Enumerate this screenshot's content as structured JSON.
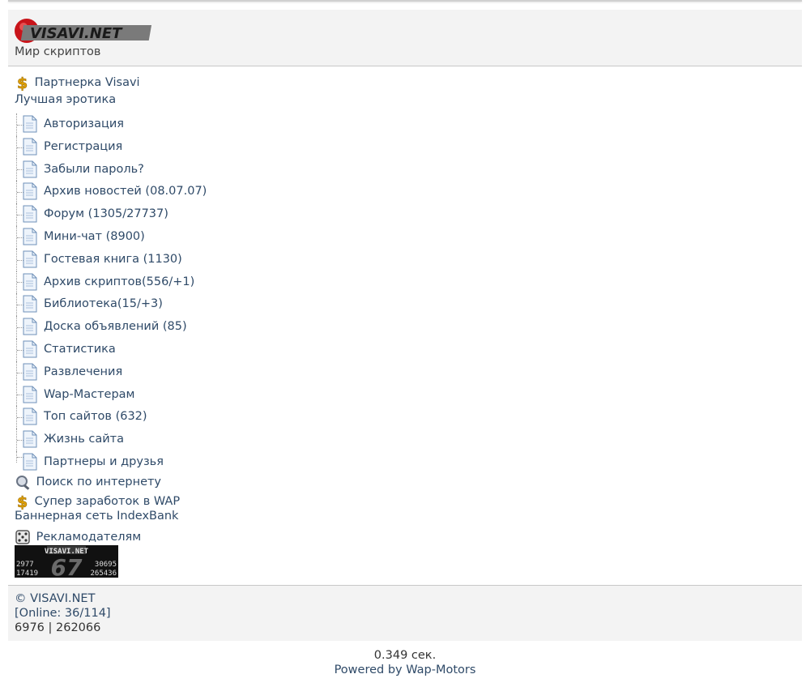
{
  "header": {
    "logo_text": "VISAVI.NET",
    "tagline": "Мир скриптов"
  },
  "top_links": {
    "partner": "Партнерка Visavi",
    "erotica": "Лучшая эротика"
  },
  "menu": [
    {
      "label": "Авторизация",
      "count": ""
    },
    {
      "label": "Регистрация",
      "count": ""
    },
    {
      "label": "Забыли пароль?",
      "count": ""
    },
    {
      "label": "Архив новостей",
      "count": " (08.07.07)"
    },
    {
      "label": "Форум",
      "count": " (1305/27737)"
    },
    {
      "label": "Мини-чат",
      "count": " (8900)"
    },
    {
      "label": "Гостевая книга",
      "count": " (1130)"
    },
    {
      "label": "Архив скриптов",
      "count": "(556/+1)"
    },
    {
      "label": "Библиотека",
      "count": "(15/+3)"
    },
    {
      "label": "Доска объявлений",
      "count": " (85)"
    },
    {
      "label": "Статистика",
      "count": ""
    },
    {
      "label": "Развлечения",
      "count": ""
    },
    {
      "label": "Wap-Мастерам",
      "count": ""
    },
    {
      "label": "Топ сайтов",
      "count": " (632)"
    },
    {
      "label": "Жизнь сайта",
      "count": ""
    },
    {
      "label": "Партнеры и друзья",
      "count": ""
    }
  ],
  "bottom_links": {
    "search": "Поиск по интернету",
    "earn": "Супер заработок в WAP",
    "banner": "Баннерная сеть IndexBank",
    "ads": "Рекламодателям"
  },
  "counter_badge": {
    "site": "VISAVI.NET",
    "left_top": "2977",
    "left_bottom": "17419",
    "big": "67",
    "right_top": "30695",
    "right_bottom": "265436"
  },
  "footer": {
    "copyright": "© VISAVI.NET",
    "online": "[Online: 36/114]",
    "stats": "6976 | 262066"
  },
  "bottom": {
    "timing": "0.349 сек.",
    "powered": "Powered by Wap-Motors"
  },
  "colors": {
    "link": "#2f4a68",
    "panel": "#f3f3f3"
  }
}
